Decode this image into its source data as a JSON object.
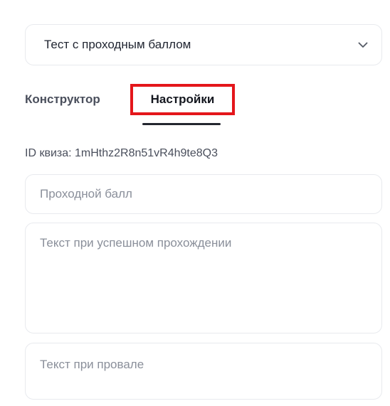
{
  "quiz_type_select": {
    "value": "Тест с проходным баллом"
  },
  "tabs": [
    {
      "label": "Конструктор",
      "active": false
    },
    {
      "label": "Настройки",
      "active": true
    }
  ],
  "quiz_id": {
    "text": "ID квиза: 1mHthz2R8n51vR4h9te8Q3"
  },
  "fields": {
    "pass_score_placeholder": "Проходной балл",
    "success_text_placeholder": "Текст при успешном прохождении",
    "fail_text_placeholder": "Текст при провале"
  },
  "colors": {
    "highlight_border": "#e4161b",
    "text_primary": "#1f2430",
    "placeholder": "#8a8f9a",
    "border": "#e8eaee"
  },
  "icons": {
    "select_chevron": "chevron-down-icon"
  }
}
